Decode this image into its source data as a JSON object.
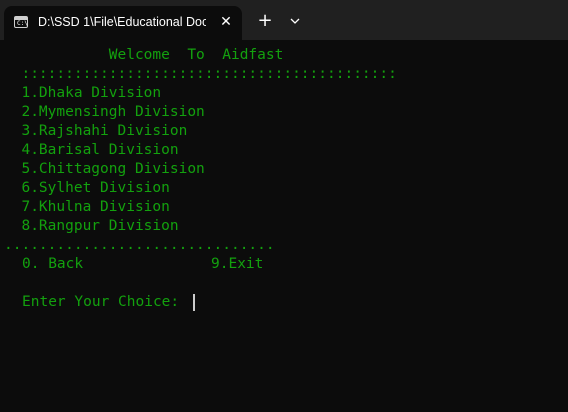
{
  "tab": {
    "title": "D:\\SSD 1\\File\\Educational Doc",
    "icon": "terminal-icon",
    "icon_prompt": "C:\\",
    "close_glyph": "✕",
    "new_tab_glyph": "+"
  },
  "terminal": {
    "welcome": "            Welcome  To  Aidfast",
    "colon_rule": "  :::::::::::::::::::::::::::::::::::::::::::",
    "divisions": [
      "  1.Dhaka Division",
      "  2.Mymensingh Division",
      "  3.Rajshahi Division",
      "  4.Barisal Division",
      "  5.Chittagong Division",
      "  6.Sylhet Division",
      "  7.Khulna Division",
      "  8.Rangpur Division"
    ],
    "dot_rule": "...............................",
    "back_label": "0. Back",
    "exit_label": "9.Exit",
    "prompt": "Enter Your Choice:"
  },
  "colors": {
    "text": "#13a10e",
    "background": "#0c0c0c",
    "titlebar": "#202020"
  }
}
